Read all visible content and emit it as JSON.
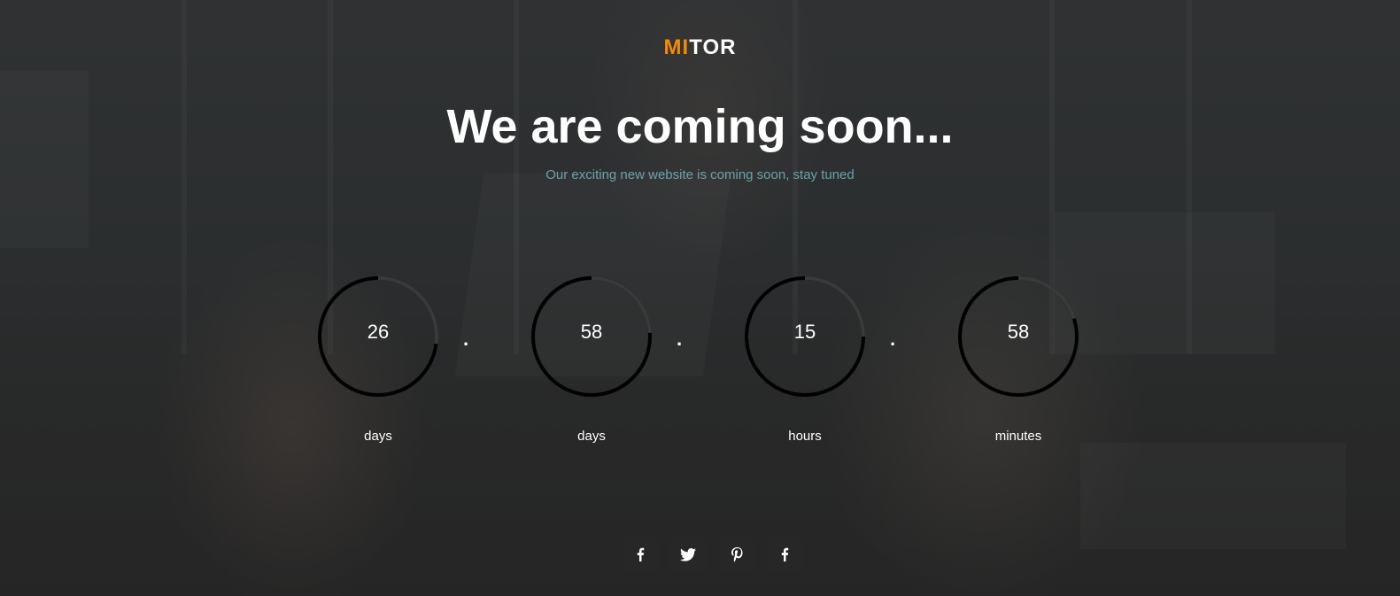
{
  "brand": {
    "logo_accent": "MI",
    "logo_rest": "TOR",
    "accent_color": "#f58a07"
  },
  "hero": {
    "title": "We are coming soon...",
    "subtitle": "Our exciting new website is coming soon, stay tuned"
  },
  "countdown": {
    "separator": ".",
    "units": [
      {
        "value": "26",
        "label": "days",
        "progress": 0.27
      },
      {
        "value": "58",
        "label": "days",
        "progress": 0.24
      },
      {
        "value": "15",
        "label": "hours",
        "progress": 0.25
      },
      {
        "value": "58",
        "label": "minutes",
        "progress": 0.2
      }
    ]
  },
  "social": [
    {
      "icon": "facebook-icon"
    },
    {
      "icon": "twitter-icon"
    },
    {
      "icon": "pinterest-icon"
    },
    {
      "icon": "facebook-icon"
    }
  ]
}
